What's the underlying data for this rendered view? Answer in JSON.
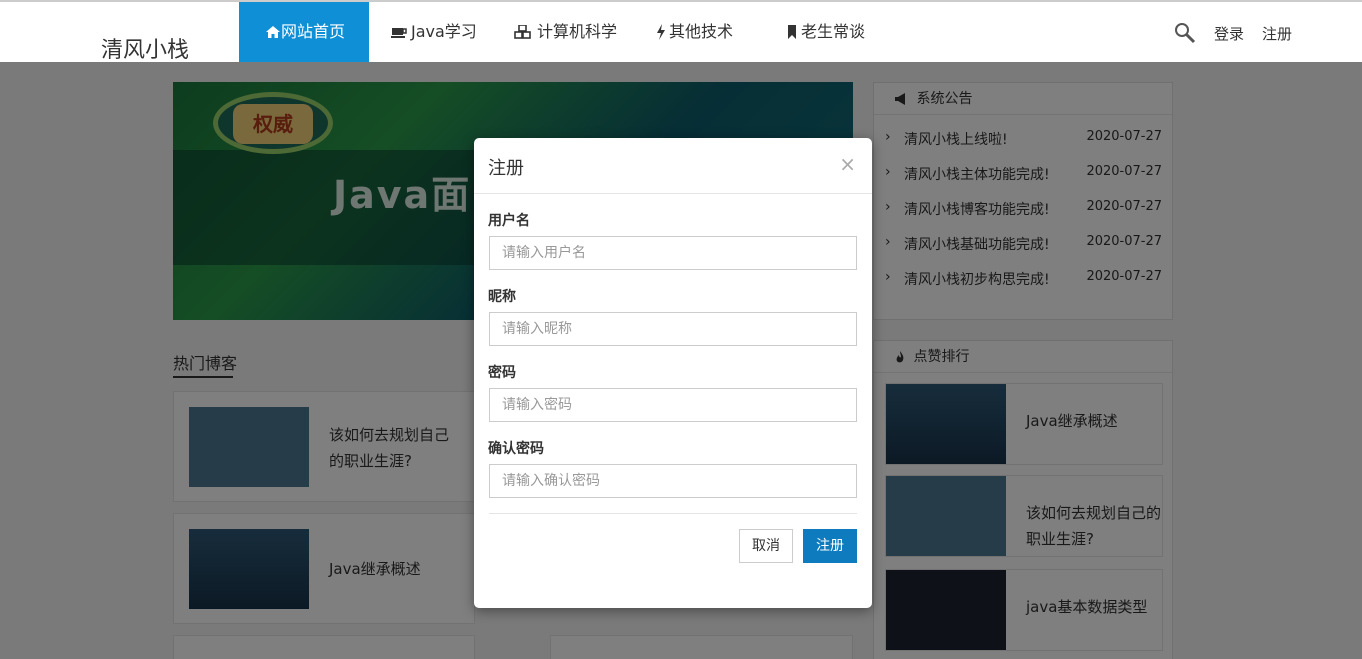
{
  "header": {
    "brand": "清风小栈",
    "nav": [
      {
        "label": "网站首页",
        "icon": "home-icon"
      },
      {
        "label": "Java学习",
        "icon": "coffee-cup-icon"
      },
      {
        "label": "计算机科学",
        "icon": "cubes-icon"
      },
      {
        "label": "其他技术",
        "icon": "lightning-icon"
      },
      {
        "label": "老生常谈",
        "icon": "bookmark-icon"
      }
    ],
    "login": "登录",
    "register": "注册"
  },
  "banner": {
    "badge_text": "权威",
    "text": "Java面"
  },
  "hot_blogs": {
    "title": "热门博客",
    "items": [
      {
        "title": "该如何去规划自己的职业生涯?"
      },
      {
        "title": "Java继承概述"
      }
    ]
  },
  "notices": {
    "title": "系统公告",
    "items": [
      {
        "text": "清风小栈上线啦!",
        "date": "2020-07-27"
      },
      {
        "text": "清风小栈主体功能完成!",
        "date": "2020-07-27"
      },
      {
        "text": "清风小栈博客功能完成!",
        "date": "2020-07-27"
      },
      {
        "text": "清风小栈基础功能完成!",
        "date": "2020-07-27"
      },
      {
        "text": "清风小栈初步构思完成!",
        "date": "2020-07-27"
      }
    ]
  },
  "ranking": {
    "title": "点赞排行",
    "items": [
      {
        "title": "Java继承概述"
      },
      {
        "title": "该如何去规划自己的职业生涯?"
      },
      {
        "title": "java基本数据类型"
      }
    ]
  },
  "modal": {
    "title": "注册",
    "close": "×",
    "fields": [
      {
        "label": "用户名",
        "placeholder": "请输入用户名"
      },
      {
        "label": "昵称",
        "placeholder": "请输入昵称"
      },
      {
        "label": "密码",
        "placeholder": "请输入密码"
      },
      {
        "label": "确认密码",
        "placeholder": "请输入确认密码"
      }
    ],
    "cancel": "取消",
    "submit": "注册"
  },
  "colors": {
    "accent": "#0e8fd6",
    "submit": "#0e7bbf"
  }
}
